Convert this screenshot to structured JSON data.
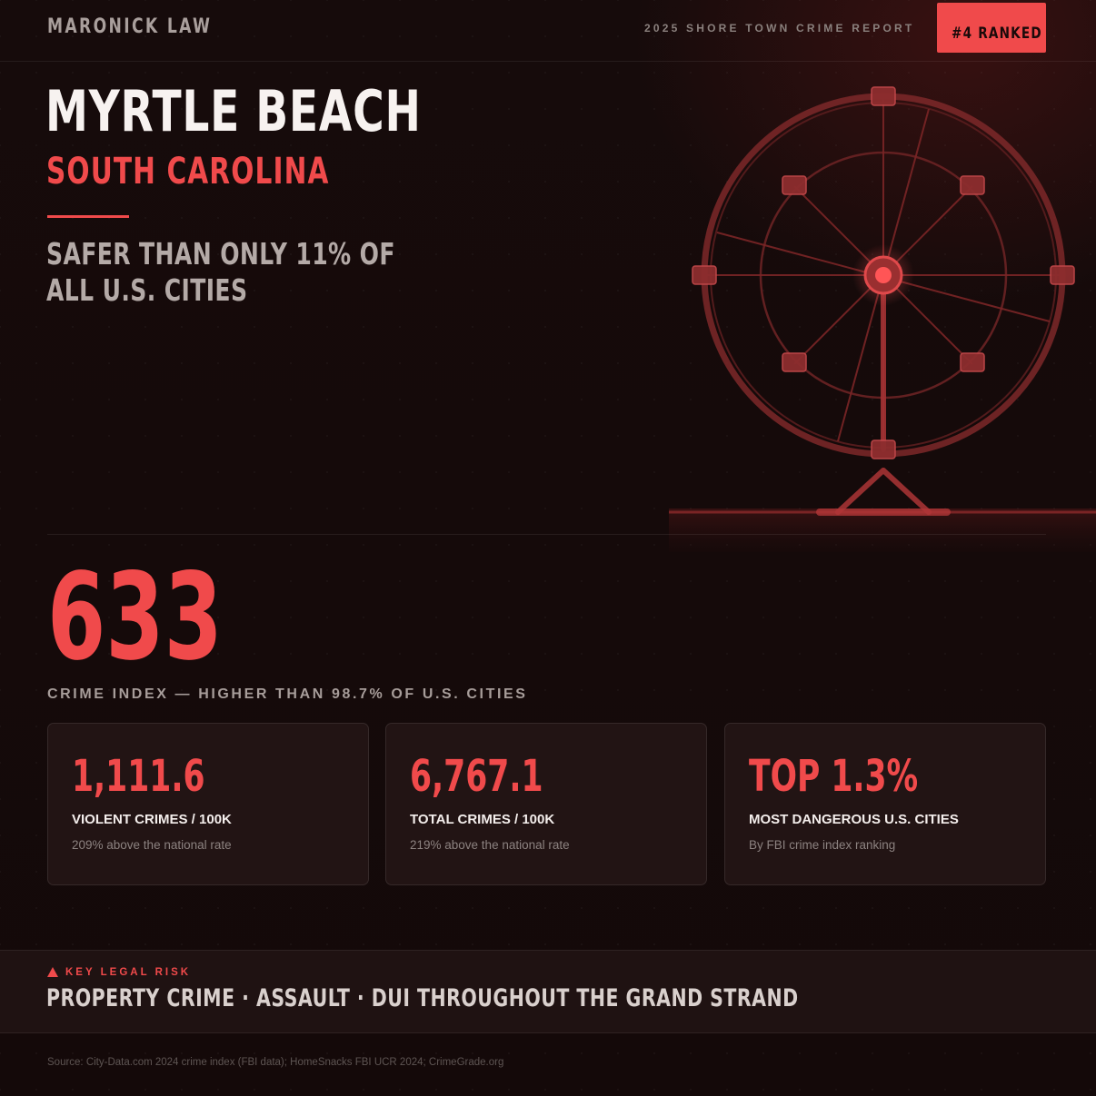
{
  "header": {
    "brand": "MARONICK LAW",
    "report_label": "2025 SHORE TOWN CRIME REPORT",
    "rank_badge": "#4 RANKED"
  },
  "hero": {
    "city": "MYRTLE BEACH",
    "state": "SOUTH CAROLINA",
    "tagline": "SAFER THAN ONLY 11% OF ALL U.S. CITIES",
    "illustration": "ferris-wheel-illustration"
  },
  "index": {
    "value": "633",
    "caption": "CRIME INDEX — HIGHER THAN 98.7% OF U.S. CITIES"
  },
  "stats": [
    {
      "value": "1,111.6",
      "label": "VIOLENT CRIMES / 100K",
      "note": "209% above the national rate"
    },
    {
      "value": "6,767.1",
      "label": "TOTAL CRIMES / 100K",
      "note": "219% above the national rate"
    },
    {
      "value": "TOP 1.3%",
      "label": "MOST DANGEROUS U.S. CITIES",
      "note": "By FBI crime index ranking"
    }
  ],
  "risk": {
    "icon": "warning-triangle-icon",
    "label": "KEY LEGAL RISK",
    "text": "PROPERTY CRIME · ASSAULT · DUI THROUGHOUT THE GRAND STRAND"
  },
  "footer": {
    "source": "Source: City-Data.com 2024 crime index (FBI data); HomeSnacks FBI UCR 2024; CrimeGrade.org"
  },
  "colors": {
    "background": "#150a0a",
    "accent": "#f04a4b",
    "card": "#221414",
    "muted_text": "#a79d9a"
  }
}
